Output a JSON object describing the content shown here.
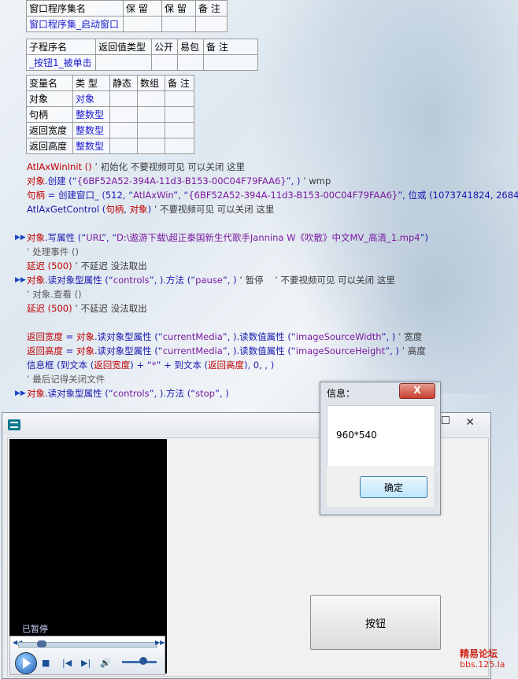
{
  "table1": {
    "headers": [
      "窗口程序集名",
      "保 留",
      "保 留",
      "备 注"
    ],
    "row": [
      "窗口程序集_启动窗口",
      "",
      "",
      ""
    ]
  },
  "table2": {
    "headers": [
      "子程序名",
      "返回值类型",
      "公开",
      "易包",
      "备 注"
    ],
    "row": [
      "_按钮1_被单击",
      "",
      "",
      "",
      ""
    ]
  },
  "table3": {
    "headers": [
      "变量名",
      "类 型",
      "静态",
      "数组",
      "备 注"
    ],
    "rows": [
      [
        "对象",
        "对象"
      ],
      [
        "句柄",
        "整数型"
      ],
      [
        "返回宽度",
        "整数型"
      ],
      [
        "返回高度",
        "整数型"
      ]
    ]
  },
  "code": {
    "l1a": "AtlAxWinInit ()",
    "l1b": "’ 初始化   不要视频可见  可以关闭 这里",
    "l2a": "对象",
    "l2b": ".创建 (“",
    "l2c": "{6BF52A52-394A-11d3-B153-00C04F79FAA6}",
    "l2d": "”, )",
    "l2e": "’ wmp",
    "l3a": "句柄",
    "l3b": " = 创建窗口_ (512, “",
    "l3c": "AtlAxWin",
    "l3d": "”, “",
    "l3e": "{6BF52A52-394A-11d3-B153-00C04F79FAA6}",
    "l3f": "”, 位或 (1073741824, 2684",
    "l4a": "AtlAxGetControl (",
    "l4b": "句柄",
    "l4c": ", ",
    "l4d": "对象",
    "l4e": ")",
    "l4f": "’ 不要视频可见   可以关闭 这里",
    "l5a": "对象",
    "l5b": ".写属性 (“",
    "l5c": "URL",
    "l5d": "”, “",
    "l5e": "D:\\遨游下载\\超正泰国新生代歌手Jannina W《吹散》中文MV_高清_1.mp4",
    "l5f": "”)",
    "l6": "’ 处理事件 ()",
    "l7a": "延迟 (500)",
    "l7b": "’ 不延迟 没法取出",
    "l8a": "对象",
    "l8b": ".读对象型属性 (“",
    "l8c": "controls",
    "l8d": "”, ).方法 (“",
    "l8e": "pause",
    "l8f": "”, )",
    "l8g": "’ 暂停",
    "l8h": "’ 不要视频可见   可以关闭 这里",
    "l9": "’ 对象.查看 ()",
    "l10a": "延迟 (500)",
    "l10b": "’ 不延迟 没法取出",
    "l11a": "返回宽度",
    "l11b": " = ",
    "l11c": "对象",
    "l11d": ".读对象型属性 (“",
    "l11e": "currentMedia",
    "l11f": "”, ).读数值属性 (“",
    "l11g": "imageSourceWidth",
    "l11h": "”, )",
    "l11i": "’ 宽度",
    "l12a": "返回高度",
    "l12b": " = ",
    "l12c": "对象",
    "l12d": ".读对象型属性 (“",
    "l12e": "currentMedia",
    "l12f": "”, ).读数值属性 (“",
    "l12g": "imageSourceHeight",
    "l12h": "”, )",
    "l12i": "’ 高度",
    "l13a": "信息框 (到文本 (",
    "l13b": "返回宽度",
    "l13c": ") + “",
    "l13d": "*",
    "l13e": "” + 到文本 (",
    "l13f": "返回高度",
    "l13g": "), 0, , )",
    "l14": "’ 最后记得关闭文件",
    "l15a": "对象",
    "l15b": ".读对象型属性 (“",
    "l15c": "controls",
    "l15d": "”, ).方法 (“",
    "l15e": "stop",
    "l15f": "”, )"
  },
  "player": {
    "status": "已暂停",
    "seek_progress": 0.17,
    "volume": 0.62
  },
  "main_button": "按钮",
  "dialog": {
    "title": "信息：",
    "close": "X",
    "message": "960*540",
    "ok": "确定"
  },
  "watermark": {
    "line1": "精易论坛",
    "line2": "bbs.125.la"
  }
}
